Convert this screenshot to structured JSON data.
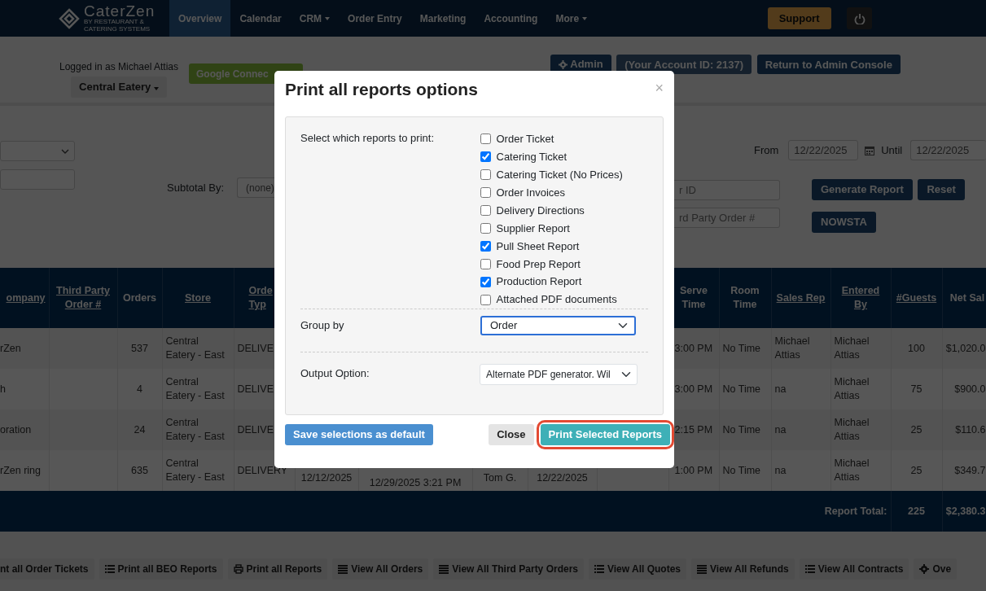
{
  "navbar": {
    "brand": "CaterZen",
    "tagline": "BY RESTAURANT & CATERING SYSTEMS",
    "items": [
      {
        "label": "Overview",
        "selected": true,
        "dropdown": false
      },
      {
        "label": "Calendar",
        "selected": false,
        "dropdown": false
      },
      {
        "label": "CRM",
        "selected": false,
        "dropdown": true
      },
      {
        "label": "Order Entry",
        "selected": false,
        "dropdown": false
      },
      {
        "label": "Marketing",
        "selected": false,
        "dropdown": false
      },
      {
        "label": "Accounting",
        "selected": false,
        "dropdown": false
      },
      {
        "label": "More",
        "selected": false,
        "dropdown": true
      }
    ],
    "support_button": "Support"
  },
  "account_bar": {
    "logged_in": "Logged in as Michael Attias",
    "store_button": "Central Eatery",
    "google_button": "Google Connec",
    "admin_button": "Admin",
    "account_id": "(Your Account ID: 2137)",
    "return_button": "Return to Admin Console"
  },
  "filters": {
    "subtotal_label": "Subtotal By:",
    "subtotal_value": "(none)",
    "from_label": "From",
    "from_value": "12/22/2025",
    "until_label": "Until",
    "until_value": "12/22/2025",
    "order_id_placeholder": "r ID",
    "third_party_placeholder": "rd Party Order #",
    "buttons": [
      "Generate Report",
      "Reset",
      "NOWSTA"
    ]
  },
  "table": {
    "columns": [
      {
        "label": "ompany",
        "sortable": true
      },
      {
        "label": "Third Party Order #",
        "sortable": true
      },
      {
        "label": "Orders",
        "sortable": false
      },
      {
        "label": "Store",
        "sortable": true
      },
      {
        "label": "Orde Typ",
        "sortable": true
      },
      {
        "label": "Serve Time",
        "sortable": false
      },
      {
        "label": "Room Time",
        "sortable": false
      },
      {
        "label": "Sales Rep",
        "sortable": true
      },
      {
        "label": "Entered By",
        "sortable": true
      },
      {
        "label": "#Guests",
        "sortable": true
      },
      {
        "label": "Net Sal",
        "sortable": false
      }
    ],
    "rows": [
      {
        "company": "rZen",
        "orders": "537",
        "store": "Central Eatery - East",
        "order_type": "DELIVE",
        "serve_time": "3:00 PM",
        "room_time": "No Time",
        "sales_rep": "Michael Attias",
        "entered_by": "Michael Attias",
        "guests": "100",
        "net_sales": "$1,020.0"
      },
      {
        "company": "h",
        "orders": "4",
        "store": "Central Eatery - East",
        "order_type": "DELIVE",
        "serve_time": "3:00 PM",
        "room_time": "No Time",
        "sales_rep": "na",
        "entered_by": "Michael Attias",
        "guests": "75",
        "net_sales": "$900.0"
      },
      {
        "company": "oration",
        "orders": "24",
        "store": "Central Eatery - East",
        "order_type": "DELIVE",
        "serve_time": "2:15 PM",
        "room_time": "No Time",
        "sales_rep": "na",
        "entered_by": "Michael Attias",
        "guests": "25",
        "net_sales": "$110.6"
      },
      {
        "company": "rZen ring",
        "orders": "635",
        "store": "Central Eatery - East",
        "order_type": "DELIVERY",
        "column_6": "12/12/2025",
        "column_7": "12/29/2025 3:21 PM",
        "column_8": "Tom G.",
        "column_9": "12/22/2025",
        "serve_time": "1:00 PM",
        "room_time": "No Time",
        "sales_rep": "na",
        "entered_by": "Michael Attias",
        "guests": "25",
        "net_sales": "$349.7"
      }
    ],
    "footer": {
      "label": "Report Total:",
      "guests": "225",
      "net_sales": "$2,380.3"
    }
  },
  "toolbar": [
    {
      "label": "nt all Order Tickets",
      "kind": "none"
    },
    {
      "label": "Print all BEO Reports",
      "kind": "list"
    },
    {
      "label": "Print all Reports",
      "kind": "printer"
    },
    {
      "label": "View All Orders",
      "kind": "table"
    },
    {
      "label": "View All Third Party Orders",
      "kind": "table"
    },
    {
      "label": "View All Quotes",
      "kind": "list"
    },
    {
      "label": "View All Refunds",
      "kind": "table"
    },
    {
      "label": "View All Contracts",
      "kind": "list"
    },
    {
      "label": "Ove",
      "kind": "gear"
    }
  ],
  "modal": {
    "title": "Print all reports options",
    "close": "×",
    "reports_label": "Select which reports to print:",
    "reports": [
      {
        "label": "Order Ticket",
        "checked": false
      },
      {
        "label": "Catering Ticket",
        "checked": true
      },
      {
        "label": "Catering Ticket (No Prices)",
        "checked": false
      },
      {
        "label": "Order Invoices",
        "checked": false
      },
      {
        "label": "Delivery Directions",
        "checked": false
      },
      {
        "label": "Supplier Report",
        "checked": false
      },
      {
        "label": "Pull Sheet Report",
        "checked": true
      },
      {
        "label": "Food Prep Report",
        "checked": false
      },
      {
        "label": "Production Report",
        "checked": true
      },
      {
        "label": "Attached PDF documents",
        "checked": false
      }
    ],
    "group_by_label": "Group by",
    "group_by_value": "Order",
    "output_label": "Output Option:",
    "output_value": "Alternate PDF generator. Wil",
    "save_button": "Save selections as default",
    "close_button": "Close",
    "print_button": "Print Selected Reports",
    "print_highlighted": true
  }
}
